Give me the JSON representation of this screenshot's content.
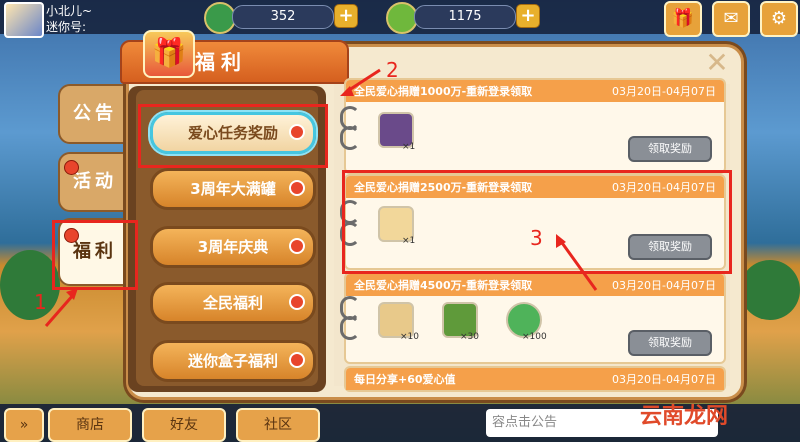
{
  "user": {
    "name": "小北儿~",
    "id_label": "迷你号:"
  },
  "currency": {
    "gems": "352",
    "coins": "1175"
  },
  "panel": {
    "title": "福利"
  },
  "side_tabs": [
    {
      "label": "公告"
    },
    {
      "label": "活动"
    },
    {
      "label": "福利"
    }
  ],
  "categories": [
    {
      "label": "爱心任务奖励",
      "selected": true
    },
    {
      "label": "3周年大满罐"
    },
    {
      "label": "3周年庆典"
    },
    {
      "label": "全民福利"
    },
    {
      "label": "迷你盒子福利"
    }
  ],
  "rewards": [
    {
      "title": "全民爱心捐赠1000万-重新登录领取",
      "date": "03月20日-04月07日",
      "items": [
        "×1"
      ],
      "claim": "领取奖励"
    },
    {
      "title": "全民爱心捐赠2500万-重新登录领取",
      "date": "03月20日-04月07日",
      "items": [
        "×1"
      ],
      "claim": "领取奖励"
    },
    {
      "title": "全民爱心捐赠4500万-重新登录领取",
      "date": "03月20日-04月07日",
      "items": [
        "×10",
        "×30",
        "×100"
      ],
      "claim": "领取奖励"
    },
    {
      "title": "每日分享+60爱心值",
      "date": "03月20日-04月07日"
    }
  ],
  "annotations": [
    "1",
    "2",
    "3"
  ],
  "bottom_bar": {
    "shop": "商店",
    "friends": "好友",
    "community": "社区",
    "notice_placeholder": "容点击公告"
  },
  "watermark": "云南龙网",
  "colors": {
    "accent_orange": "#f5a04a",
    "annotation_red": "#e8261e",
    "selected_cyan": "#46c6e0"
  }
}
